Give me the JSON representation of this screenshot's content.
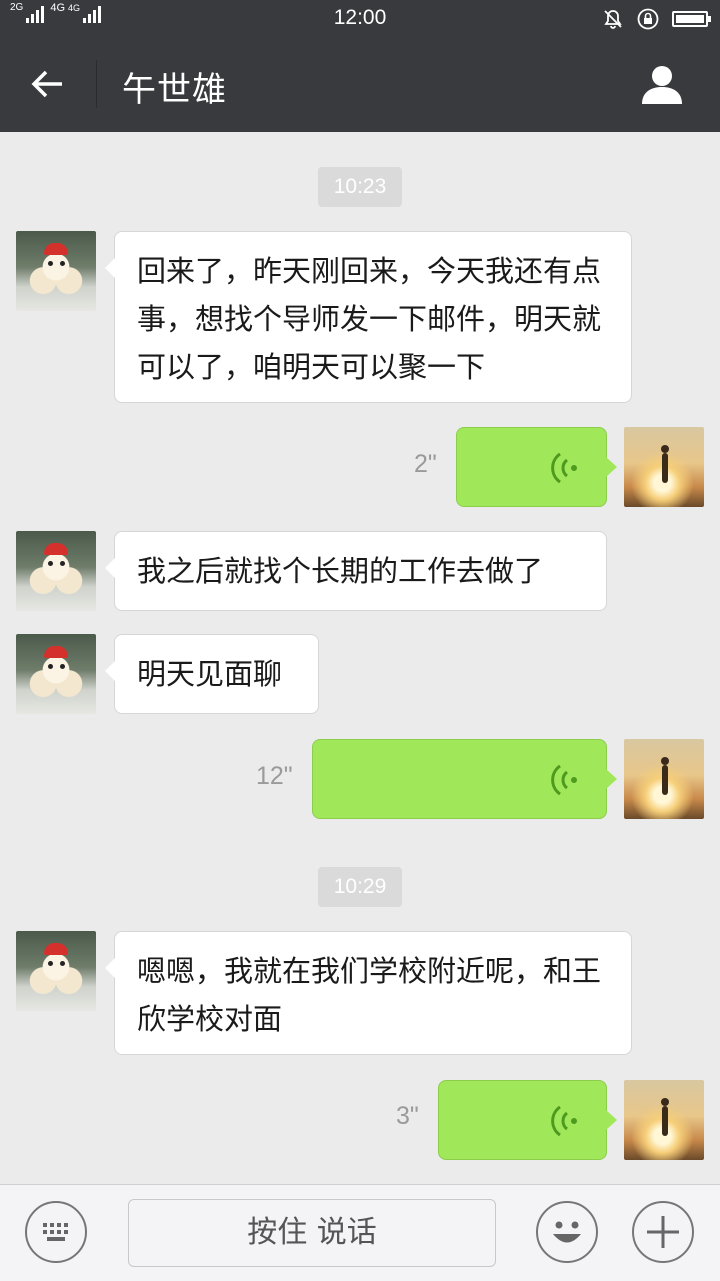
{
  "status_bar": {
    "time": "12:00",
    "network_1": "2G",
    "network_2": "4G",
    "network_3": "4G",
    "icons": [
      "signal-icon",
      "bell-off-icon",
      "lock-rotation-icon",
      "battery-icon"
    ]
  },
  "header": {
    "title": "午世雄",
    "back_icon": "back-arrow-icon",
    "profile_icon": "profile-icon"
  },
  "messages": {
    "time_1": "10:23",
    "msg_1": "回来了，昨天刚回来，今天我还有点事，想找个导师发一下邮件，明天就可以了，咱明天可以聚一下",
    "voice_1_duration": "2\"",
    "msg_2": "我之后就找个长期的工作去做了",
    "msg_3": "明天见面聊",
    "voice_2_duration": "12\"",
    "time_2": "10:29",
    "msg_4": "嗯嗯，我就在我们学校附近呢，和王欣学校对面",
    "voice_3_duration": "3\""
  },
  "input_bar": {
    "hold_to_talk_label": "按住 说话",
    "icons": [
      "keyboard-icon",
      "emoji-icon",
      "plus-icon"
    ]
  },
  "colors": {
    "header_bg": "#393a3e",
    "chat_bg": "#ebebeb",
    "outgoing_bubble": "#a0e75a",
    "incoming_bubble": "#ffffff"
  }
}
